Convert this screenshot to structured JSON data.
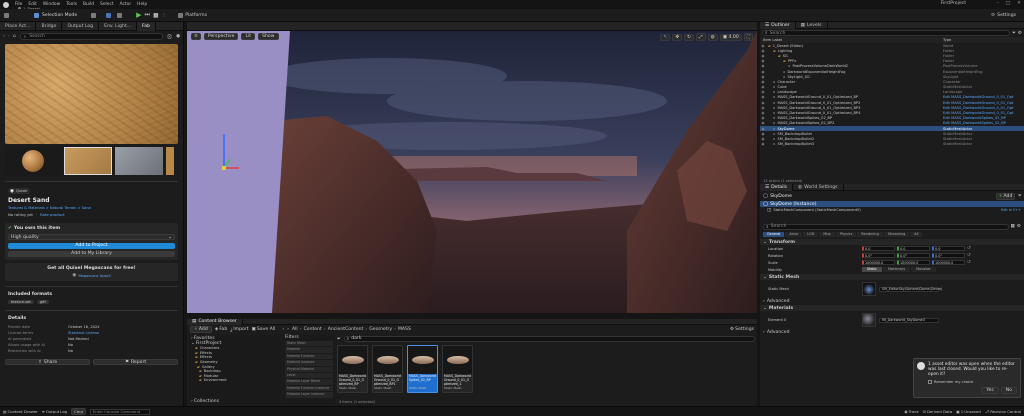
{
  "menu": {
    "tab_title": "1_Desert",
    "items": [
      "File",
      "Edit",
      "Window",
      "Tools",
      "Build",
      "Select",
      "Actor",
      "Help"
    ],
    "project_name": "FirstProject"
  },
  "toolbar": {
    "selection_mode": "Selection Mode",
    "platforms": "Platforms",
    "settings": "Settings"
  },
  "left_panel": {
    "tabs": [
      "Place Act...",
      "Bridge",
      "Output Log",
      "Env. Light...",
      "Fab"
    ],
    "search_placeholder": "Search",
    "quixel_label": "Quixel",
    "asset_title": "Desert Sand",
    "breadcrumb": "Textures & Materials > Natural Terrain > Sand",
    "rating_text": "No rating yet",
    "rate_link": "Rate product",
    "you_own_label": "You own this item",
    "quality_value": "High quality",
    "add_to_project": "Add to Project",
    "add_to_library": "Add to My Library",
    "get_free_title": "Get all Quixel Megascans for free!",
    "megascans_link": "Megascans Upsell",
    "included_formats_label": "Included formats",
    "format_tags": [
      "texture-set",
      "gltf"
    ],
    "details_label": "Details",
    "details_rows": [
      {
        "key": "Publish date",
        "value": "October 16, 2024"
      },
      {
        "key": "License terms",
        "value": "Standard License"
      },
      {
        "key": "AI generated",
        "value": "Not Marked"
      },
      {
        "key": "Allows usage with AI",
        "value": "No"
      },
      {
        "key": "Restriction with AI",
        "value": "No"
      }
    ],
    "share_label": "Share",
    "report_label": "Report"
  },
  "viewport": {
    "perspective": "Perspective",
    "lit": "Lit",
    "show": "Show",
    "speed": "4.00"
  },
  "content_browser": {
    "tab": "Content Browser",
    "add": "Add",
    "fab": "Fab",
    "import": "Import",
    "save_all": "Save All",
    "path": [
      "All",
      "Content",
      "AncientContent",
      "Geometry",
      "MASS"
    ],
    "settings": "Settings",
    "favorites": "Favorites",
    "tree_root": "FirstProject",
    "tree_items": [
      "Characters",
      "Effects",
      "Effects",
      "Geometry",
      "Gallery",
      "Backdrop",
      "Modular",
      "Environment"
    ],
    "collections": "Collections",
    "filters_label": "Filters",
    "filter_items": [
      "Static Mesh",
      "Material",
      "Material Function",
      "Material Instance",
      "Physical Material",
      "Level",
      "Material Layer Blend",
      "Material Function Instance",
      "Material Layer Instance"
    ],
    "search_value": "dark",
    "assets": [
      {
        "name": "MASS_DarkworldGround_0_01_Optimized_BP",
        "type": "Static Mesh"
      },
      {
        "name": "MASS_DarkworldGround_0_01_Optimized_BP1",
        "type": "Static Mesh"
      },
      {
        "name": "MASS_DarkworldSpikes_02_BP",
        "type": "Static Mesh"
      },
      {
        "name": "MASS_DarkworldGround_0_01_Optimized_1",
        "type": "Static Mesh"
      }
    ],
    "count_text": "4 items (1 selected)"
  },
  "outliner": {
    "tabs": [
      "Outliner",
      "Levels"
    ],
    "search_placeholder": "Search",
    "col_label": "Item Label",
    "col_type": "Type",
    "rows": [
      {
        "label": "1_Desert (Editor)",
        "type": "World",
        "indent": 0,
        "sel": false
      },
      {
        "label": "Lighting",
        "type": "Folder",
        "indent": 1,
        "sel": false
      },
      {
        "label": "SG",
        "type": "Folder",
        "indent": 2,
        "sel": false
      },
      {
        "label": "PPFx",
        "type": "Folder",
        "indent": 3,
        "sel": false
      },
      {
        "label": "PostProcessVolumeDarkWorld2",
        "type": "PostProcessVolume",
        "indent": 4,
        "sel": false
      },
      {
        "label": "DarkworldExponentialHeightFog",
        "type": "ExponentialHeightFog",
        "indent": 3,
        "sel": false
      },
      {
        "label": "SkyLight_SG",
        "type": "SkyLight",
        "indent": 3,
        "sel": false
      },
      {
        "label": "Character",
        "type": "Character",
        "indent": 1,
        "sel": false
      },
      {
        "label": "Cube",
        "type": "StaticMeshActor",
        "indent": 1,
        "sel": false
      },
      {
        "label": "Landscape",
        "type": "Landscape",
        "indent": 1,
        "sel": false
      },
      {
        "label": "MASS_DarkworldGround_0_01_Optimized_BP",
        "type": "Edit MASS_DarkworldGround_0_01_Opt",
        "indent": 1,
        "sel": false
      },
      {
        "label": "MASS_DarkworldGround_0_01_Optimized_BP2",
        "type": "Edit MASS_DarkworldGround_0_01_Opt",
        "indent": 1,
        "sel": false
      },
      {
        "label": "MASS_DarkworldGround_0_01_Optimized_BP3",
        "type": "Edit MASS_DarkworldGround_0_01_Opt",
        "indent": 1,
        "sel": false
      },
      {
        "label": "MASS_DarkworldGround_0_01_Optimized_BP4",
        "type": "Edit MASS_DarkworldGround_0_01_Opt",
        "indent": 1,
        "sel": false
      },
      {
        "label": "MASS_DarkworldSpikes_02_BP",
        "type": "Edit MASS_DarkworldSpikes_02_BP",
        "indent": 1,
        "sel": false
      },
      {
        "label": "MASS_DarkworldSpikes_02_BP2",
        "type": "Edit MASS_DarkworldSpikes_02_BP",
        "indent": 1,
        "sel": false
      },
      {
        "label": "SkyDome",
        "type": "StaticMeshActor",
        "indent": 1,
        "sel": true
      },
      {
        "label": "SM_BackdropBullet",
        "type": "StaticMeshActor",
        "indent": 1,
        "sel": false
      },
      {
        "label": "SM_BackdropBullet2",
        "type": "StaticMeshActor",
        "indent": 1,
        "sel": false
      },
      {
        "label": "SM_BackdropBullet3",
        "type": "StaticMeshActor",
        "indent": 1,
        "sel": false
      }
    ],
    "count_text": "13 actors (1 selected)"
  },
  "details": {
    "tabs": [
      "Details",
      "World Settings"
    ],
    "actor_name": "SkyDome",
    "add_label": "Add",
    "component_root": "SkyDome (Instance)",
    "component_child": "StaticMeshComponent (StaticMeshComponent0)",
    "edit_in_cpp": "Edit in C++",
    "search_placeholder": "Search",
    "filter_tabs": [
      "General",
      "Actor",
      "LOD",
      "Misc",
      "Physics",
      "Rendering",
      "Streaming",
      "All"
    ],
    "transform_label": "Transform",
    "transform_rows": [
      {
        "label": "Location",
        "x": "0.0",
        "y": "0.0",
        "z": "0.0"
      },
      {
        "label": "Rotation",
        "x": "0.0°",
        "y": "0.0°",
        "z": "0.0°"
      },
      {
        "label": "Scale",
        "x": "1000000.0",
        "y": "1000000.0",
        "z": "1000000.0"
      }
    ],
    "mobility_label": "Mobility",
    "mobility_options": [
      "Static",
      "Stationary",
      "Movable"
    ],
    "static_mesh_section": "Static Mesh",
    "static_mesh_label": "Static Mesh",
    "static_mesh_value": "SM_EditorSky(Sphere)Dome(Geom)",
    "advanced_1": "Advanced",
    "materials_section": "Materials",
    "element_label": "Element 0",
    "material_value": "MI_Darkworld_SkyDome3",
    "advanced_2": "Advanced"
  },
  "toast": {
    "text": "1 asset editor was open when the editor was last closed. Would you like to re-open it?",
    "remember": "Remember my choice",
    "yes": "Yes",
    "no": "No"
  },
  "status": {
    "content_drawer": "Content Drawer",
    "output_log": "Output Log",
    "cmd": "Cmd",
    "console_placeholder": "Enter Console Command",
    "trace": "Trace",
    "derived_data": "Derived Data",
    "unsaved": "1 Unsaved",
    "revision_control": "Revision Control"
  }
}
